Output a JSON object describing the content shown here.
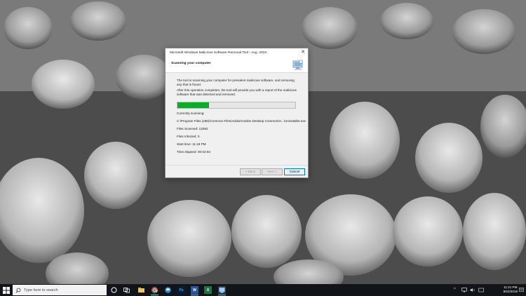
{
  "dialog": {
    "title": "Microsoft Windows Malicious Software Removal Tool - Aug. 2019",
    "header": "Scanning your computer",
    "paragraph1": "The tool is scanning your computer for prevalent malicious software, and removing any that is found.",
    "paragraph2": "After this operation completes, the tool will provide you with a report of the malicious software that was detected and removed.",
    "progress_fraction": 0.27,
    "currently_scanning_label": "Currently scanning:",
    "current_file": "C:\\Program Files (x86)\\Common Files\\Adobe\\Adobe Desktop Common\\H...\\Uninstaller.exe",
    "files_scanned": "Files Scanned: 12082",
    "files_infected": "Files Infected: 0",
    "start_time": "Start time: 11:18 PM",
    "time_elapsed": "Time elapsed: 00:02:03",
    "buttons": {
      "back": "< Back",
      "next": "Next >",
      "cancel": "Cancel"
    },
    "close_glyph": "✕"
  },
  "taskbar": {
    "search_placeholder": "Type here to search",
    "apps": [
      "task-view-icon",
      "edge-icon",
      "file-explorer-icon",
      "chrome-icon",
      "edge-browser-icon",
      "photoshop-icon",
      "word-icon",
      "excel-icon",
      "mrt-icon"
    ],
    "app_labels": {
      "photoshop": "Ps",
      "word": "W",
      "excel": "X"
    },
    "clock_time": "11:21 PM",
    "clock_date": "9/22/2019",
    "accent_color": "#0078d7",
    "progress_color": "#06b025"
  }
}
